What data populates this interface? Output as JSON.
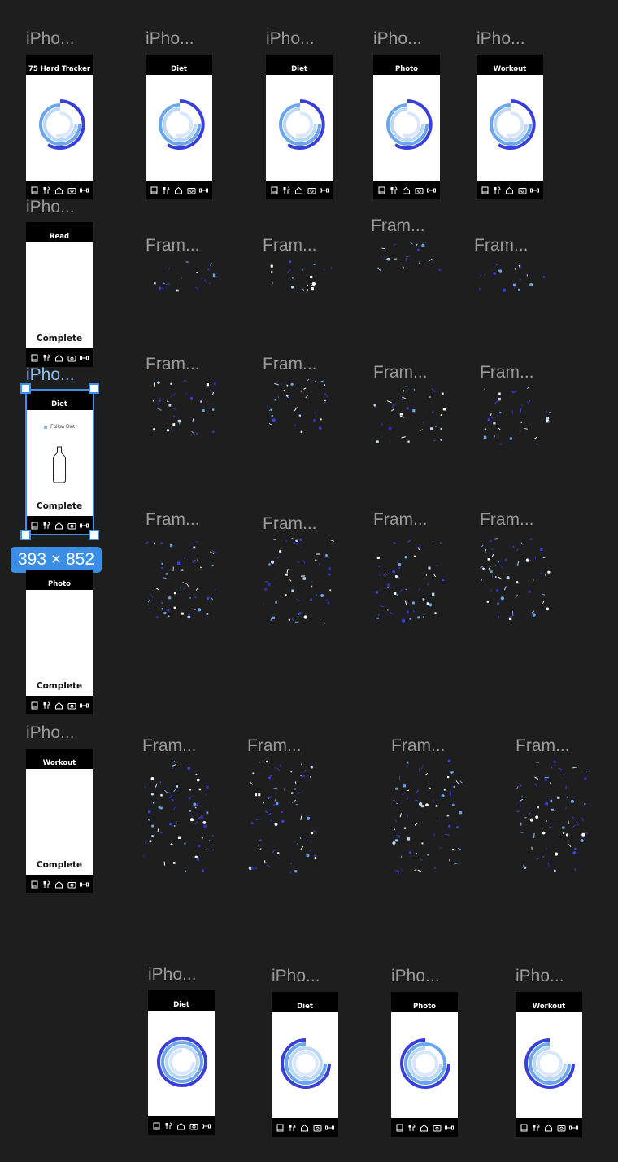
{
  "canvas": {
    "background": "#1e1e1e"
  },
  "labels": {
    "iphone": "iPho...",
    "frame": "Fram..."
  },
  "screens": {
    "tracker_title": "75 Hard Tracker",
    "diet": "Diet",
    "photo": "Photo",
    "workout": "Workout",
    "read": "Read",
    "complete": "Complete",
    "follow_diet": "Follow Diet"
  },
  "nav_icons": [
    "book-icon",
    "utensils-icon",
    "home-icon",
    "camera-icon",
    "dumbbell-icon"
  ],
  "selection": {
    "size_label": "393 × 852"
  },
  "colors": {
    "ring_dark": "#3b3fd9",
    "ring_mid": "#6aa6ee",
    "ring_light": "#bcd7f5",
    "selection": "#3b8ff0",
    "confetti": [
      "#3b3fd9",
      "#6aa6ee",
      "#bcd7f5",
      "#ffffff",
      "#2f2fb8"
    ]
  }
}
